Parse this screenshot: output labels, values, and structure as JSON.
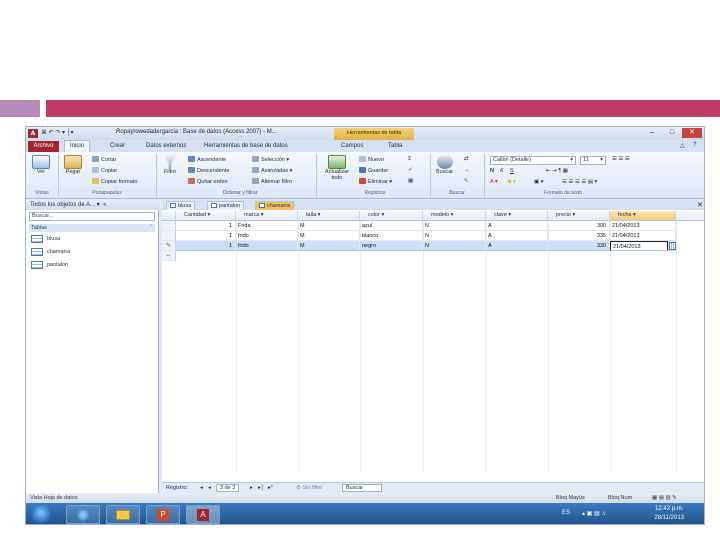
{
  "window": {
    "title": "Ropayrowedadergarcia : Base de datos (Access 2007) - M...",
    "context_tab": "Herramientas de tabla",
    "quick_access": "⌘ ↶ ↷ ▾ │▾",
    "controls": [
      "–",
      "□",
      "✕"
    ]
  },
  "ribbon_tabs": [
    "Archivo",
    "Inicio",
    "Crear",
    "Datos externos",
    "Herramientas de base de datos",
    "Campos",
    "Tabla"
  ],
  "ribbon": {
    "vistas": {
      "label": "Vistas",
      "ver": "Ver"
    },
    "portapapeles": {
      "label": "Portapapeles",
      "pegar": "Pegar",
      "cortar": "Cortar",
      "copiar": "Copiar",
      "copiar_formato": "Copiar formato"
    },
    "ordenar": {
      "label": "Ordenar y filtrar",
      "filtro": "Filtro",
      "ascendente": "Ascendente",
      "descendente": "Descendente",
      "quitar_orden": "Quitar orden",
      "seleccion": "Selección",
      "avanzadas": "Avanzadas",
      "alternar_filtro": "Alternar filtro"
    },
    "registros": {
      "label": "Registros",
      "actualizar": "Actualizar todo",
      "nuevo": "Nuevo",
      "guardar": "Guardar",
      "eliminar": "Eliminar"
    },
    "buscar": {
      "label": "Buscar",
      "buscar": "Buscar"
    },
    "formato": {
      "label": "Formato de texto",
      "font": "Calibri (Detalle)",
      "size": "11"
    }
  },
  "nav_pane": {
    "title": "Todos los objetos de A...",
    "search_placeholder": "Buscar...",
    "section": "Tablas",
    "items": [
      "blusa",
      "chamarra",
      "pantalon"
    ]
  },
  "doc_tabs": [
    "blusa",
    "pantalon",
    "chamarra"
  ],
  "table": {
    "columns": [
      "Cantidad",
      "marca",
      "talla",
      "color",
      "modelo",
      "clave",
      "precio",
      "fecha"
    ],
    "rows": [
      [
        "1",
        "Frida",
        "M",
        "azul",
        "N",
        "A",
        "300",
        "21/04/2013"
      ],
      [
        "1",
        "frido",
        "M",
        "blanco",
        "N",
        "A",
        "335",
        "21/04/2013"
      ],
      [
        "1",
        "frido",
        "M",
        "negro",
        "N",
        "A",
        "330",
        "21/04/2013"
      ]
    ],
    "new_row_marker": "⇔"
  },
  "record_nav": {
    "label": "Registro:",
    "position": "3 de 3",
    "nav_buttons": [
      "◂",
      "◂",
      "▸",
      "▸│",
      "▸*"
    ],
    "filter": "Sin filtro",
    "search": "Buscar"
  },
  "status": {
    "left": "Vista Hoja de datos",
    "caps": "Bloq Mayús",
    "num": "Bloq Num"
  },
  "taskbar": {
    "time": "12:42 p.m.",
    "date": "28/11/2013",
    "lang": "ES"
  },
  "colors": {
    "access_red": "#a4262c",
    "deco_square": "#b78bb8",
    "deco_bar": "#bf3c66",
    "selected_row": "#cbe0f7",
    "active_tab": "#f3c35a"
  }
}
